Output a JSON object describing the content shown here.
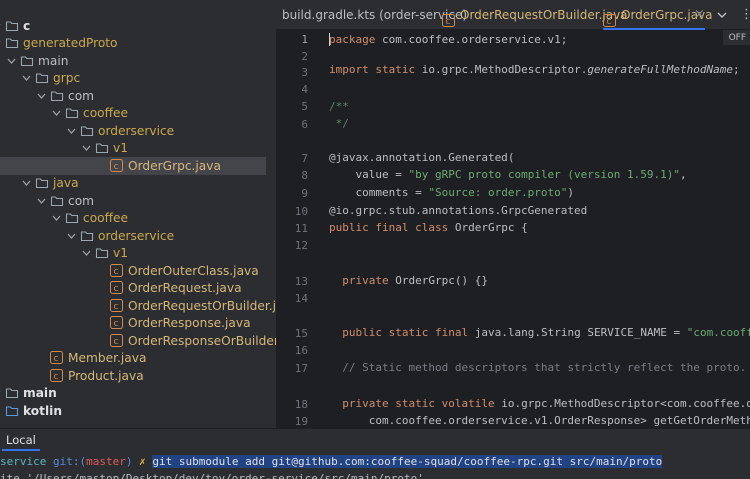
{
  "project_tree": {
    "items": [
      {
        "label": "c",
        "icon": "folder-icon",
        "style": "white",
        "expanded": true
      },
      {
        "label": "generatedProto",
        "icon": "folder-icon",
        "style": "gen",
        "expanded": true
      },
      {
        "label": "main",
        "icon": "folder-icon",
        "style": "folder",
        "expanded": true
      },
      {
        "label": "grpc",
        "icon": "folder-icon",
        "style": "gen",
        "expanded": true
      },
      {
        "label": "com",
        "icon": "folder-icon",
        "style": "folder",
        "expanded": true
      },
      {
        "label": "cooffee",
        "icon": "folder-icon",
        "style": "gen",
        "expanded": true
      },
      {
        "label": "orderservice",
        "icon": "folder-icon",
        "style": "gen",
        "expanded": true
      },
      {
        "label": "v1",
        "icon": "folder-icon",
        "style": "gen",
        "expanded": true
      },
      {
        "label": "OrderGrpc.java",
        "icon": "java-class-icon",
        "style": "java",
        "selected": true
      },
      {
        "label": "java",
        "icon": "folder-icon",
        "style": "gen",
        "expanded": true
      },
      {
        "label": "com",
        "icon": "folder-icon",
        "style": "folder",
        "expanded": true
      },
      {
        "label": "cooffee",
        "icon": "folder-icon",
        "style": "gen",
        "expanded": true
      },
      {
        "label": "orderservice",
        "icon": "folder-icon",
        "style": "gen",
        "expanded": true
      },
      {
        "label": "v1",
        "icon": "folder-icon",
        "style": "gen",
        "expanded": true
      },
      {
        "label": "OrderOuterClass.java",
        "icon": "java-class-icon",
        "style": "java"
      },
      {
        "label": "OrderRequest.java",
        "icon": "java-class-icon",
        "style": "java"
      },
      {
        "label": "OrderRequestOrBuilder.java",
        "icon": "java-class-icon",
        "style": "java"
      },
      {
        "label": "OrderResponse.java",
        "icon": "java-class-icon",
        "style": "java"
      },
      {
        "label": "OrderResponseOrBuilder.java",
        "icon": "java-class-icon",
        "style": "java"
      },
      {
        "label": "Member.java",
        "icon": "java-class-icon",
        "style": "java"
      },
      {
        "label": "Product.java",
        "icon": "java-class-icon",
        "style": "java"
      },
      {
        "label": "main",
        "icon": "folder-icon",
        "style": "white",
        "expanded": true
      },
      {
        "label": "kotlin",
        "icon": "folder-icon",
        "style": "white"
      }
    ]
  },
  "tabs": [
    {
      "label": "build.gradle.kts (order-service)",
      "icon": "gradle-file-icon",
      "active": false
    },
    {
      "label": "OrderRequestOrBuilder.java",
      "icon": "java-class-icon",
      "active": false
    },
    {
      "label": "OrderGrpc.java",
      "icon": "java-class-icon",
      "active": true
    }
  ],
  "tab_close_glyph": "×",
  "tab_more_glyph": "⋮",
  "editor": {
    "reader_mode_badge": "OFF",
    "line_numbers": [
      "1",
      "2",
      "3",
      "4",
      "5",
      "6",
      "7",
      "8",
      "9",
      "10",
      "11",
      "12",
      "13",
      "14",
      "15",
      "16",
      "17",
      "18",
      "19"
    ],
    "code": {
      "l1": [
        "package",
        " com.cooffee.orderservice.v1;"
      ],
      "l3": [
        "import",
        " ",
        "static",
        " io.grpc.MethodDescriptor.",
        "generateFullMethodName",
        ";"
      ],
      "l5": "/**",
      "l6": " */",
      "l7": [
        "@javax.annotation.Generated",
        "("
      ],
      "l8": [
        "    value = ",
        "\"by gRPC proto compiler (version 1.59.1)\"",
        ","
      ],
      "l9": [
        "    comments = ",
        "\"Source: order.proto\"",
        ")"
      ],
      "l10": "@io.grpc.stub.annotations.GrpcGenerated",
      "l11": [
        "public",
        " ",
        "final",
        " ",
        "class",
        " OrderGrpc {"
      ],
      "l13": [
        "  ",
        "private",
        " ",
        "OrderGrpc",
        "() {}"
      ],
      "l15": [
        "  ",
        "public",
        " ",
        "static",
        " ",
        "final",
        " java.lang.String ",
        "SERVICE_NAME",
        " = ",
        "\"com.cooffee.orderse"
      ],
      "l17": "  // Static method descriptors that strictly reflect the proto.",
      "l18": [
        "  ",
        "private",
        " ",
        "static",
        " ",
        "volatile",
        " io.grpc.MethodDescriptor<com.cooffee.orderse"
      ],
      "l19": [
        "      com.cooffee.orderservice.v1.OrderResponse> ",
        "getGetOrderMethod",
        ";"
      ]
    }
  },
  "terminal": {
    "tab_label": "Local",
    "prompt_dir": "service",
    "prompt_git": "git:",
    "prompt_paren_open": "(",
    "prompt_branch": "master",
    "prompt_paren_close": ")",
    "prompt_mark": "✗",
    "command": "git submodule add git@github.com:cooffee-squad/cooffee-rpc.git src/main/proto",
    "output_partial": "ite '/Users/mastop/Desktop/dev/toy/order-service/src/main/proto'"
  }
}
